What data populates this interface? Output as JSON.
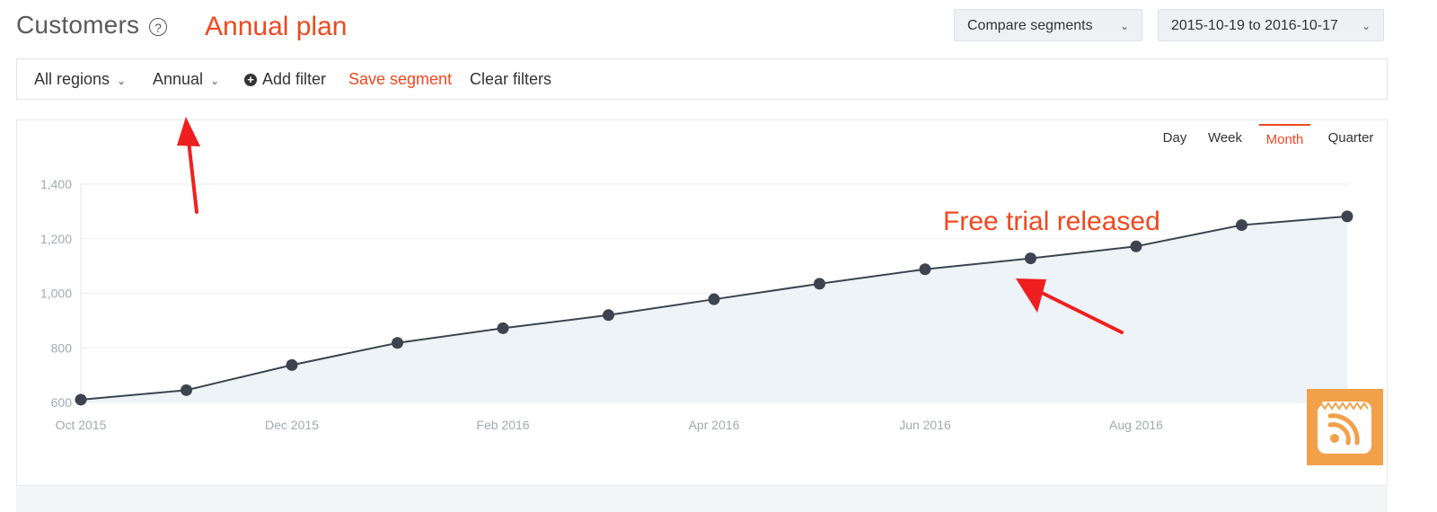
{
  "header": {
    "title": "Customers",
    "help_icon_glyph": "?",
    "annotation": "Annual plan",
    "compare_label": "Compare segments",
    "date_range": "2015-10-19 to 2016-10-17"
  },
  "filters": {
    "region": "All regions",
    "plan": "Annual",
    "add_filter": "Add filter",
    "save_segment": "Save segment",
    "clear_filters": "Clear filters"
  },
  "periods": [
    "Day",
    "Week",
    "Month",
    "Quarter"
  ],
  "active_period": "Month",
  "annotation_chart": "Free trial released",
  "colors": {
    "accent": "#f0481f",
    "line": "#3d4450",
    "area": "#eef3f8",
    "badge": "#f3a04a"
  },
  "icons": {
    "help": "question-circle-icon",
    "chevron": "chevron-down-icon",
    "add": "plus-circle-icon",
    "badge": "rss-feed-icon"
  },
  "chart_data": {
    "type": "area",
    "x": [
      "2015-10",
      "2015-11",
      "2015-12",
      "2016-01",
      "2016-02",
      "2016-03",
      "2016-04",
      "2016-05",
      "2016-06",
      "2016-07",
      "2016-08",
      "2016-09",
      "2016-10"
    ],
    "x_tick_labels": [
      {
        "index": 0,
        "label": "Oct 2015"
      },
      {
        "index": 2,
        "label": "Dec 2015"
      },
      {
        "index": 4,
        "label": "Feb 2016"
      },
      {
        "index": 6,
        "label": "Apr 2016"
      },
      {
        "index": 8,
        "label": "Jun 2016"
      },
      {
        "index": 10,
        "label": "Aug 2016"
      }
    ],
    "series": [
      {
        "values": [
          610,
          645,
          737,
          818,
          872,
          920,
          978,
          1035,
          1088,
          1128,
          1172,
          1250,
          1282
        ]
      }
    ],
    "ylim": [
      600,
      1400
    ],
    "y_ticks": [
      600,
      800,
      1000,
      1200,
      1400
    ],
    "y_tick_labels": [
      "600",
      "800",
      "1,000",
      "1,200",
      "1,400"
    ],
    "grid": true
  }
}
